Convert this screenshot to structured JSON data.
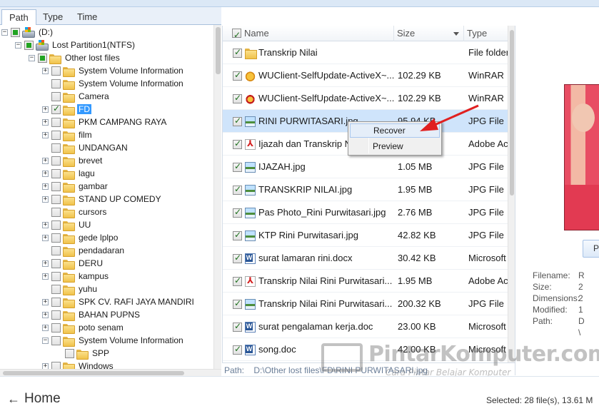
{
  "tabs": [
    "Path",
    "Type",
    "Time"
  ],
  "tree": [
    {
      "level": 0,
      "expand": "minus",
      "check": "partial",
      "icon": "drive",
      "label": "(D:)"
    },
    {
      "level": 1,
      "expand": "minus",
      "check": "partial",
      "icon": "drive",
      "label": "Lost Partition1(NTFS)"
    },
    {
      "level": 2,
      "expand": "minus",
      "check": "partial",
      "icon": "folder",
      "label": "Other lost files"
    },
    {
      "level": 3,
      "expand": "plus",
      "check": "none",
      "icon": "folder",
      "label": "System Volume Information"
    },
    {
      "level": 3,
      "expand": "none",
      "check": "none",
      "icon": "folder",
      "label": "System Volume Information"
    },
    {
      "level": 3,
      "expand": "none",
      "check": "none",
      "icon": "folder",
      "label": "Camera"
    },
    {
      "level": 3,
      "expand": "plus",
      "check": "checked",
      "icon": "folder",
      "label": "FD",
      "selected": true
    },
    {
      "level": 3,
      "expand": "plus",
      "check": "none",
      "icon": "folder",
      "label": "PKM CAMPANG RAYA"
    },
    {
      "level": 3,
      "expand": "plus",
      "check": "none",
      "icon": "folder",
      "label": "film"
    },
    {
      "level": 3,
      "expand": "none",
      "check": "none",
      "icon": "folder",
      "label": "UNDANGAN"
    },
    {
      "level": 3,
      "expand": "plus",
      "check": "none",
      "icon": "folder",
      "label": "brevet"
    },
    {
      "level": 3,
      "expand": "plus",
      "check": "none",
      "icon": "folder",
      "label": "lagu"
    },
    {
      "level": 3,
      "expand": "plus",
      "check": "none",
      "icon": "folder",
      "label": "gambar"
    },
    {
      "level": 3,
      "expand": "plus",
      "check": "none",
      "icon": "folder",
      "label": "STAND UP COMEDY"
    },
    {
      "level": 3,
      "expand": "none",
      "check": "none",
      "icon": "folder",
      "label": "cursors"
    },
    {
      "level": 3,
      "expand": "plus",
      "check": "none",
      "icon": "folder",
      "label": "UU"
    },
    {
      "level": 3,
      "expand": "plus",
      "check": "none",
      "icon": "folder",
      "label": "gede lplpo"
    },
    {
      "level": 3,
      "expand": "none",
      "check": "none",
      "icon": "folder",
      "label": "pendadaran"
    },
    {
      "level": 3,
      "expand": "plus",
      "check": "none",
      "icon": "folder",
      "label": "DERU"
    },
    {
      "level": 3,
      "expand": "plus",
      "check": "none",
      "icon": "folder",
      "label": "kampus"
    },
    {
      "level": 3,
      "expand": "none",
      "check": "none",
      "icon": "folder",
      "label": "yuhu"
    },
    {
      "level": 3,
      "expand": "plus",
      "check": "none",
      "icon": "folder",
      "label": "SPK CV. RAFI JAYA MANDIRI"
    },
    {
      "level": 3,
      "expand": "plus",
      "check": "none",
      "icon": "folder",
      "label": "BAHAN PUPNS"
    },
    {
      "level": 3,
      "expand": "plus",
      "check": "none",
      "icon": "folder",
      "label": "poto senam"
    },
    {
      "level": 3,
      "expand": "minus",
      "check": "none",
      "icon": "folder",
      "label": "System Volume Information"
    },
    {
      "level": 4,
      "expand": "none",
      "check": "none",
      "icon": "folder",
      "label": "SPP"
    },
    {
      "level": 3,
      "expand": "plus",
      "check": "none",
      "icon": "folder",
      "label": "Windows"
    }
  ],
  "list": {
    "columns": {
      "name": "Name",
      "size": "Size",
      "type": "Type"
    },
    "rows": [
      {
        "icon": "folder",
        "name": "Transkrip Nilai",
        "size": "",
        "type": "File folder"
      },
      {
        "icon": "exe",
        "name": "WUClient-SelfUpdate-ActiveX~...",
        "size": "102.29 KB",
        "type": "WinRAR"
      },
      {
        "icon": "exe2",
        "name": "WUClient-SelfUpdate-ActiveX~...",
        "size": "102.29 KB",
        "type": "WinRAR"
      },
      {
        "icon": "image",
        "name": "RINI PURWITASARI.jpg",
        "size": "95.94 KB",
        "type": "JPG File",
        "selected": true
      },
      {
        "icon": "pdf",
        "name": "Ijazah dan Transkrip N",
        "size": "",
        "type": "Adobe Ac"
      },
      {
        "icon": "image",
        "name": "IJAZAH.jpg",
        "size": "1.05 MB",
        "type": "JPG File"
      },
      {
        "icon": "image",
        "name": "TRANSKRIP NILAI.jpg",
        "size": "1.95 MB",
        "type": "JPG File"
      },
      {
        "icon": "image",
        "name": "Pas Photo_Rini Purwitasari.jpg",
        "size": "2.76 MB",
        "type": "JPG File"
      },
      {
        "icon": "image",
        "name": "KTP Rini Purwitasari.jpg",
        "size": "42.82 KB",
        "type": "JPG File"
      },
      {
        "icon": "doc",
        "name": "surat lamaran rini.docx",
        "size": "30.42 KB",
        "type": "Microsoft"
      },
      {
        "icon": "pdf",
        "name": "Transkrip Nilai Rini Purwitasari...",
        "size": "1.95 MB",
        "type": "Adobe Ac"
      },
      {
        "icon": "image",
        "name": "Transkrip Nilai Rini Purwitasari...",
        "size": "200.32 KB",
        "type": "JPG File"
      },
      {
        "icon": "doc",
        "name": "surat pengalaman kerja.doc",
        "size": "23.00 KB",
        "type": "Microsoft"
      },
      {
        "icon": "doc",
        "name": "song.doc",
        "size": "42.00 KB",
        "type": "Microsoft"
      }
    ]
  },
  "path_bar": {
    "label": "Path:",
    "value": "D:\\Other lost files\\FD\\RINI PURWITASARI.jpg"
  },
  "context_menu": {
    "items": [
      "Recover",
      "Preview"
    ]
  },
  "preview": {
    "button_label": "P",
    "meta": [
      {
        "label": "Filename:",
        "value": "R"
      },
      {
        "label": "Size:",
        "value": "2"
      },
      {
        "label": "Dimensions:",
        "value": "2"
      },
      {
        "label": "Modified:",
        "value": "1"
      },
      {
        "label": "Path:",
        "value": "D"
      }
    ],
    "path_cont": "\\"
  },
  "bottom": {
    "home_label": "Home",
    "status": "Selected: 28 file(s), 13.61 M"
  },
  "watermark": {
    "title": "PintarKomputer.com",
    "subtitle": "Cara Pintar Belajar Komputer"
  },
  "colors": {
    "selection": "#3399ff",
    "row_selected": "#cfe4fb",
    "arrow": "#e02020",
    "check": "#1b6e1b"
  }
}
